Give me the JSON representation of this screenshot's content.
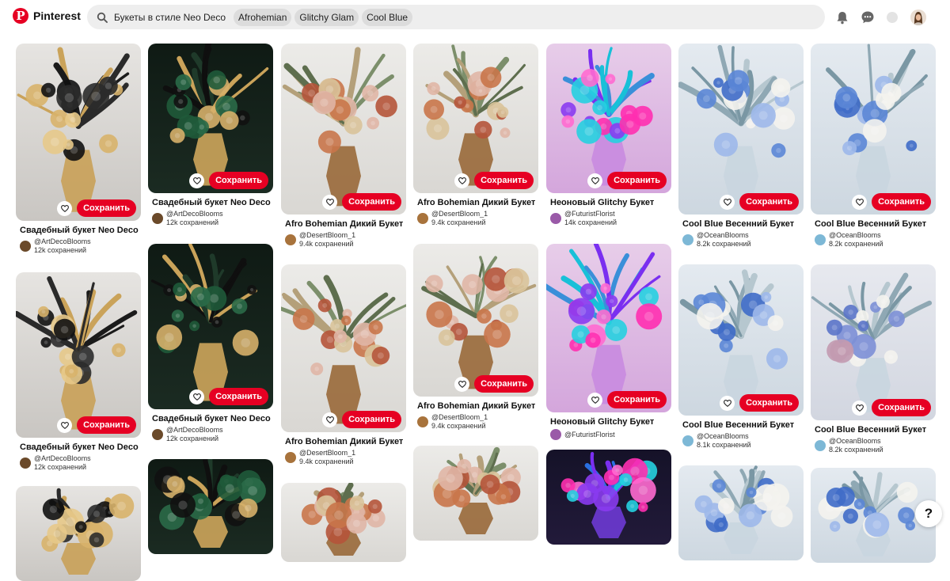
{
  "header": {
    "logo_text": "Pinterest",
    "search_query": "Букеты в стиле Neo Deco",
    "chips": [
      "Afrohemian",
      "Glitchy Glam",
      "Cool Blue"
    ]
  },
  "help_label": "?",
  "colors": {
    "brand": "#e60023",
    "search_bg": "#eeeeee"
  },
  "pins": [
    {
      "theme": "deco-black",
      "title": "Свадебный букет Neo Deco",
      "author": "@ArtDecoBlooms",
      "saves": "12k сохранений",
      "save": "Сохранить",
      "avatar": "#6b4a2a"
    },
    {
      "theme": "deco-black",
      "title": "Свадебный букет Neo Deco",
      "author": "@ArtDecoBlooms",
      "saves": "12k сохранений",
      "save": "Сохранить",
      "avatar": "#6b4a2a"
    },
    {
      "theme": "deco-black",
      "title": "",
      "author": "",
      "saves": "",
      "save": "",
      "avatar": "#6b4a2a"
    },
    {
      "theme": "deco-green",
      "title": "Свадебный букет Neo Deco",
      "author": "@ArtDecoBlooms",
      "saves": "12k сохранений",
      "save": "Сохранить",
      "avatar": "#6b4a2a"
    },
    {
      "theme": "deco-green",
      "title": "Свадебный букет Neo Deco",
      "author": "@ArtDecoBlooms",
      "saves": "12k сохранений",
      "save": "Сохранить",
      "avatar": "#6b4a2a"
    },
    {
      "theme": "deco-green",
      "title": "",
      "author": "",
      "saves": "",
      "save": "",
      "avatar": "#6b4a2a"
    },
    {
      "theme": "afro",
      "title": "Afro Bohemian Дикий Букет",
      "author": "@DesertBloom_1",
      "saves": "9.4k сохранений",
      "save": "Сохранить",
      "avatar": "#a8733c"
    },
    {
      "theme": "afro",
      "title": "Afro Bohemian Дикий Букет",
      "author": "@DesertBloom_1",
      "saves": "9.4k сохранений",
      "save": "Сохранить",
      "avatar": "#a8733c"
    },
    {
      "theme": "afro",
      "title": "",
      "author": "",
      "saves": "",
      "save": "",
      "avatar": "#a8733c"
    },
    {
      "theme": "afro",
      "title": "Afro Bohemian Дикий Букет",
      "author": "@DesertBloom_1",
      "saves": "9.4k сохранений",
      "save": "Сохранить",
      "avatar": "#a8733c"
    },
    {
      "theme": "afro",
      "title": "Afro Bohemian Дикий Букет",
      "author": "@DesertBloom_1",
      "saves": "9.4k сохранений",
      "save": "Сохранить",
      "avatar": "#a8733c"
    },
    {
      "theme": "afro",
      "title": "",
      "author": "",
      "saves": "",
      "save": "",
      "avatar": "#a8733c"
    },
    {
      "theme": "neon",
      "title": "Неоновый Glitchy Букет",
      "author": "@FuturistFlorist",
      "saves": "14k сохранений",
      "save": "Сохранить",
      "avatar": "#9a5aa8"
    },
    {
      "theme": "neon",
      "title": "Неоновый Glitchy Букет",
      "author": "@FuturistFlorist",
      "saves": "",
      "save": "Сохранить",
      "avatar": "#9a5aa8"
    },
    {
      "theme": "neon-dark",
      "title": "",
      "author": "",
      "saves": "",
      "save": "",
      "avatar": "#9a5aa8"
    },
    {
      "theme": "blue",
      "title": "Cool Blue Весенний Букет",
      "author": "@OceanBlooms",
      "saves": "8.2k сохранений",
      "save": "Сохранить",
      "avatar": "#7db8d6"
    },
    {
      "theme": "blue",
      "title": "Cool Blue Весенний Букет",
      "author": "@OceanBlooms",
      "saves": "8.1k сохранений",
      "save": "Сохранить",
      "avatar": "#7db8d6"
    },
    {
      "theme": "blue",
      "title": "",
      "author": "",
      "saves": "",
      "save": "",
      "avatar": "#7db8d6"
    },
    {
      "theme": "blue",
      "title": "Cool Blue Весенний Букет",
      "author": "@OceanBlooms",
      "saves": "8.2k сохранений",
      "save": "Сохранить",
      "avatar": "#7db8d6"
    },
    {
      "theme": "blue-lav",
      "title": "Cool Blue Весенний Букет",
      "author": "@OceanBlooms",
      "saves": "8.2k сохранений",
      "save": "Сохранить",
      "avatar": "#7db8d6"
    },
    {
      "theme": "blue",
      "title": "",
      "author": "",
      "saves": "",
      "save": "",
      "avatar": "#7db8d6"
    }
  ]
}
